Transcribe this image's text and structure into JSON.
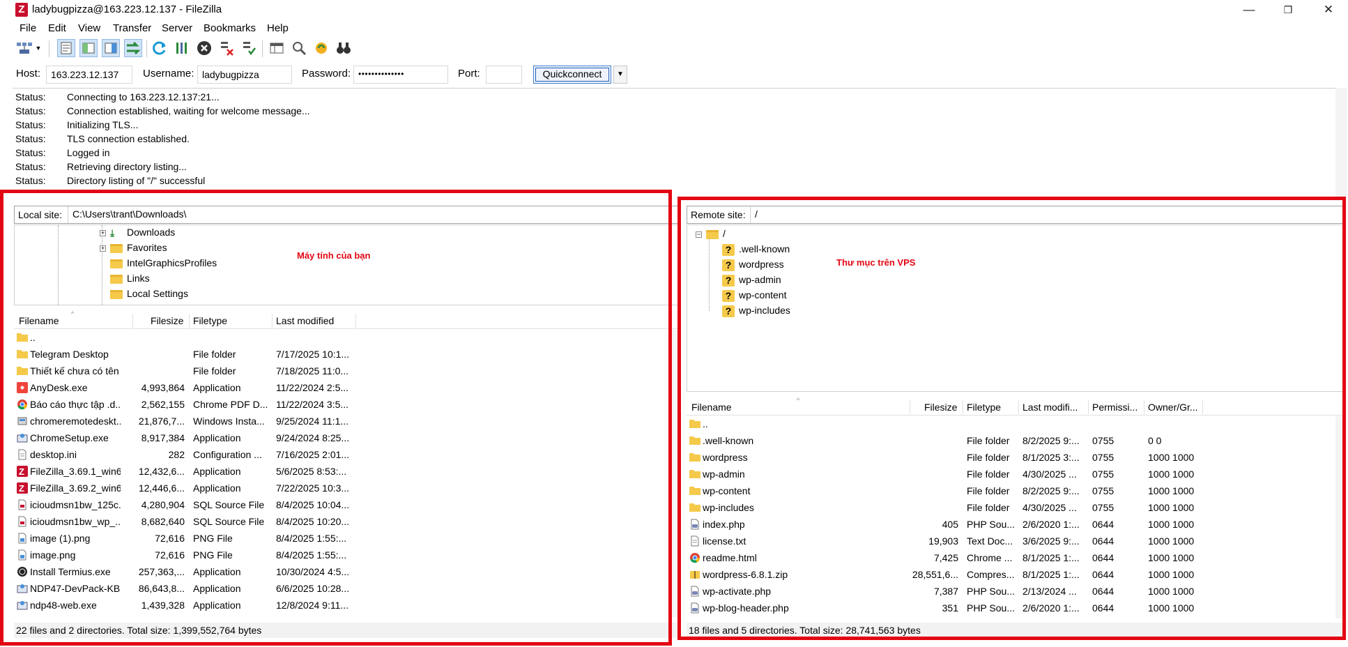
{
  "window": {
    "title": "ladybugpizza@163.223.12.137 - FileZilla",
    "minimize": "—",
    "maximize": "❐",
    "close": "✕"
  },
  "menu": [
    "File",
    "Edit",
    "View",
    "Transfer",
    "Server",
    "Bookmarks",
    "Help"
  ],
  "quickconnect": {
    "host_label": "Host:",
    "host": "163.223.12.137",
    "username_label": "Username:",
    "username": "ladybugpizza",
    "password_label": "Password:",
    "password": "••••••••••••••",
    "port_label": "Port:",
    "port": "",
    "button": "Quickconnect"
  },
  "log": [
    {
      "k": "Status:",
      "v": "Connecting to 163.223.12.137:21..."
    },
    {
      "k": "Status:",
      "v": "Connection established, waiting for welcome message..."
    },
    {
      "k": "Status:",
      "v": "Initializing TLS..."
    },
    {
      "k": "Status:",
      "v": "TLS connection established."
    },
    {
      "k": "Status:",
      "v": "Logged in"
    },
    {
      "k": "Status:",
      "v": "Retrieving directory listing..."
    },
    {
      "k": "Status:",
      "v": "Directory listing of \"/\" successful"
    }
  ],
  "local": {
    "site_label": "Local site:",
    "path": "C:\\Users\\trant\\Downloads\\",
    "annotation": "Máy tính của bạn",
    "tree": [
      "Downloads",
      "Favorites",
      "IntelGraphicsProfiles",
      "Links",
      "Local Settings"
    ],
    "columns": [
      "Filename",
      "Filesize",
      "Filetype",
      "Last modified"
    ],
    "files": [
      {
        "name": "..",
        "size": "",
        "type": "",
        "mod": "",
        "icon": "folder"
      },
      {
        "name": "Telegram Desktop",
        "size": "",
        "type": "File folder",
        "mod": "7/17/2025 10:1...",
        "icon": "folder"
      },
      {
        "name": "Thiết kế chưa có tên",
        "size": "",
        "type": "File folder",
        "mod": "7/18/2025 11:0...",
        "icon": "folder"
      },
      {
        "name": "AnyDesk.exe",
        "size": "4,993,864",
        "type": "Application",
        "mod": "11/22/2024 2:5...",
        "icon": "anydesk"
      },
      {
        "name": "Báo cáo thực tập .d...",
        "size": "2,562,155",
        "type": "Chrome PDF D...",
        "mod": "11/22/2024 3:5...",
        "icon": "chrome"
      },
      {
        "name": "chromeremotedeskt...",
        "size": "21,876,7...",
        "type": "Windows Insta...",
        "mod": "9/25/2024 11:1...",
        "icon": "installer"
      },
      {
        "name": "ChromeSetup.exe",
        "size": "8,917,384",
        "type": "Application",
        "mod": "9/24/2024 8:25...",
        "icon": "setup"
      },
      {
        "name": "desktop.ini",
        "size": "282",
        "type": "Configuration ...",
        "mod": "7/16/2025 2:01...",
        "icon": "doc"
      },
      {
        "name": "FileZilla_3.69.1_win6...",
        "size": "12,432,6...",
        "type": "Application",
        "mod": "5/6/2025 8:53:...",
        "icon": "filezilla"
      },
      {
        "name": "FileZilla_3.69.2_win6...",
        "size": "12,446,6...",
        "type": "Application",
        "mod": "7/22/2025 10:3...",
        "icon": "filezilla"
      },
      {
        "name": "icioudmsn1bw_125c...",
        "size": "4,280,904",
        "type": "SQL Source File",
        "mod": "8/4/2025 10:04...",
        "icon": "sql"
      },
      {
        "name": "icioudmsn1bw_wp_...",
        "size": "8,682,640",
        "type": "SQL Source File",
        "mod": "8/4/2025 10:20...",
        "icon": "sql"
      },
      {
        "name": "image (1).png",
        "size": "72,616",
        "type": "PNG File",
        "mod": "8/4/2025 1:55:...",
        "icon": "png"
      },
      {
        "name": "image.png",
        "size": "72,616",
        "type": "PNG File",
        "mod": "8/4/2025 1:55:...",
        "icon": "png"
      },
      {
        "name": "Install Termius.exe",
        "size": "257,363,...",
        "type": "Application",
        "mod": "10/30/2024 4:5...",
        "icon": "termius"
      },
      {
        "name": "NDP47-DevPack-KB...",
        "size": "86,643,8...",
        "type": "Application",
        "mod": "6/6/2025 10:28...",
        "icon": "setup"
      },
      {
        "name": "ndp48-web.exe",
        "size": "1,439,328",
        "type": "Application",
        "mod": "12/8/2024 9:11...",
        "icon": "setup"
      }
    ],
    "status": "22 files and 2 directories. Total size: 1,399,552,764 bytes"
  },
  "remote": {
    "site_label": "Remote site:",
    "path": "/",
    "annotation": "Thư mục trên VPS",
    "tree_root": "/",
    "tree": [
      ".well-known",
      "wordpress",
      "wp-admin",
      "wp-content",
      "wp-includes"
    ],
    "columns": [
      "Filename",
      "Filesize",
      "Filetype",
      "Last modifi...",
      "Permissi...",
      "Owner/Gr..."
    ],
    "files": [
      {
        "name": "..",
        "size": "",
        "type": "",
        "mod": "",
        "perm": "",
        "owner": "",
        "icon": "folder"
      },
      {
        "name": ".well-known",
        "size": "",
        "type": "File folder",
        "mod": "8/2/2025 9:...",
        "perm": "0755",
        "owner": "0 0",
        "icon": "folder"
      },
      {
        "name": "wordpress",
        "size": "",
        "type": "File folder",
        "mod": "8/1/2025 3:...",
        "perm": "0755",
        "owner": "1000 1000",
        "icon": "folder"
      },
      {
        "name": "wp-admin",
        "size": "",
        "type": "File folder",
        "mod": "4/30/2025 ...",
        "perm": "0755",
        "owner": "1000 1000",
        "icon": "folder"
      },
      {
        "name": "wp-content",
        "size": "",
        "type": "File folder",
        "mod": "8/2/2025 9:...",
        "perm": "0755",
        "owner": "1000 1000",
        "icon": "folder"
      },
      {
        "name": "wp-includes",
        "size": "",
        "type": "File folder",
        "mod": "4/30/2025 ...",
        "perm": "0755",
        "owner": "1000 1000",
        "icon": "folder"
      },
      {
        "name": "index.php",
        "size": "405",
        "type": "PHP Sou...",
        "mod": "2/6/2020 1:...",
        "perm": "0644",
        "owner": "1000 1000",
        "icon": "php"
      },
      {
        "name": "license.txt",
        "size": "19,903",
        "type": "Text Doc...",
        "mod": "3/6/2025 9:...",
        "perm": "0644",
        "owner": "1000 1000",
        "icon": "doc"
      },
      {
        "name": "readme.html",
        "size": "7,425",
        "type": "Chrome ...",
        "mod": "8/1/2025 1:...",
        "perm": "0644",
        "owner": "1000 1000",
        "icon": "chrome"
      },
      {
        "name": "wordpress-6.8.1.zip",
        "size": "28,551,6...",
        "type": "Compres...",
        "mod": "8/1/2025 1:...",
        "perm": "0644",
        "owner": "1000 1000",
        "icon": "zip"
      },
      {
        "name": "wp-activate.php",
        "size": "7,387",
        "type": "PHP Sou...",
        "mod": "2/13/2024 ...",
        "perm": "0644",
        "owner": "1000 1000",
        "icon": "php"
      },
      {
        "name": "wp-blog-header.php",
        "size": "351",
        "type": "PHP Sou...",
        "mod": "2/6/2020 1:...",
        "perm": "0644",
        "owner": "1000 1000",
        "icon": "php"
      }
    ],
    "status": "18 files and 5 directories. Total size: 28,741,563 bytes"
  },
  "colors": {
    "annotation_red": "#e30613",
    "folder": "#f5c94a",
    "filezilla": "#c8102e"
  }
}
